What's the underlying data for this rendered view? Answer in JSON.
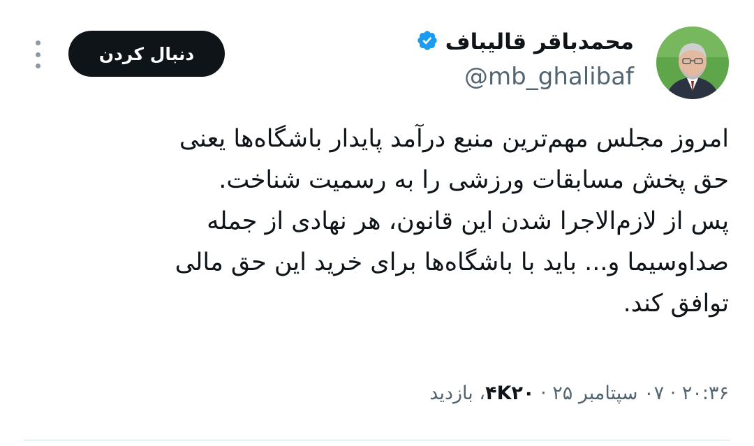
{
  "header": {
    "display_name": "محمدباقر قالیباف",
    "handle": "@mb_ghalibaf",
    "follow_label": "دنبال کردن",
    "verified_color": "#1d9bf0"
  },
  "icons": {
    "more": "more-vertical-icon",
    "verified": "verified-badge-icon"
  },
  "tweet": {
    "lines": [
      "امروز مجلس مهم‌ترین منبع درآمد پایدار باشگاه‌ها یعنی",
      "حق پخش مسابقات ورزشی را به رسمیت شناخت.",
      "پس از لازم‌الاجرا شدن این قانون، هر نهادی از جمله",
      "صداوسیما و... باید با باشگاه‌ها برای خرید این حق مالی",
      "توافق کند."
    ]
  },
  "meta": {
    "time": "۲۰:۳۶",
    "separator": "·",
    "date": "۰۷ سپتامبر ۲۵",
    "views_count": "۴K۲۰",
    "views_label": "، بازدید"
  }
}
